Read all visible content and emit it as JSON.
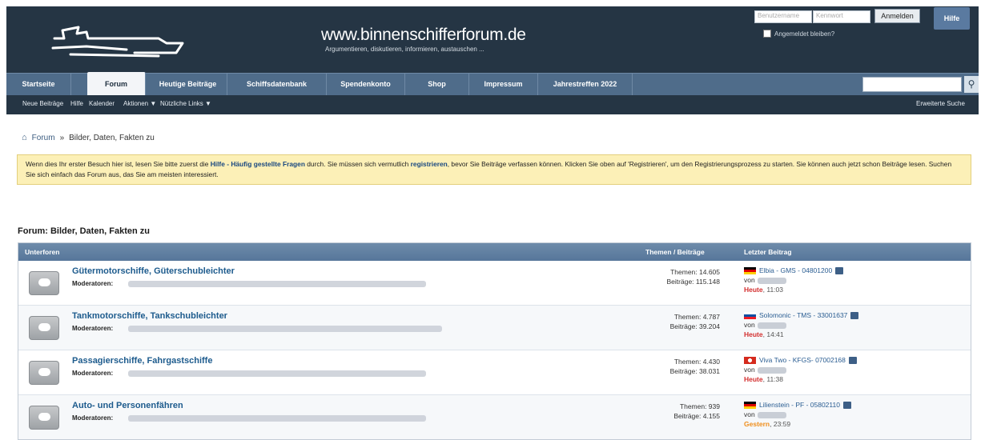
{
  "header": {
    "site_title": "www.binnenschifferforum.de",
    "site_subtitle": "Argumentieren, diskutieren, informieren, austauschen ...",
    "login": {
      "username_placeholder": "Benutzername",
      "password_placeholder": "Kennwort",
      "login_button": "Anmelden",
      "remember_label": "Angemeldet bleiben?"
    },
    "help_button": "Hilfe"
  },
  "nav": {
    "tabs": [
      "Startseite",
      "Forum",
      "Heutige Beiträge",
      "Schiffsdatenbank",
      "Spendenkonto",
      "Shop",
      "Impressum",
      "Jahrestreffen 2022"
    ],
    "active_tab": "Forum",
    "search_icon": "search-icon"
  },
  "subnav": {
    "links": [
      "Neue Beiträge",
      "Hilfe",
      "Kalender",
      "Aktionen ▼",
      "Nützliche Links ▼"
    ],
    "advanced_search": "Erweiterte Suche"
  },
  "breadcrumb": {
    "root": "Forum",
    "separator": "»",
    "current": "Bilder, Daten, Fakten zu"
  },
  "notice": {
    "part1": "Wenn dies Ihr erster Besuch hier ist, lesen Sie bitte zuerst die ",
    "link1": "Hilfe - Häufig gestellte Fragen",
    "part2": " durch. Sie müssen sich vermutlich ",
    "link2": "registrieren",
    "part3": ", bevor Sie Beiträge verfassen können. Klicken Sie oben auf 'Registrieren', um den Registrierungsprozess zu starten. Sie können auch jetzt schon Beiträge lesen. Suchen Sie sich einfach das Forum aus, das Sie am meisten interessiert."
  },
  "forum_heading": "Forum: Bilder, Daten, Fakten zu",
  "table": {
    "col_subforums": "Unterforen",
    "col_stats": "Themen / Beiträge",
    "col_last": "Letzter Beitrag",
    "rows": [
      {
        "title": "Gütermotorschiffe, Güterschubleichter",
        "mods_label": "Moderatoren:",
        "topics": "Themen: 14.605",
        "posts": "Beiträge: 115.148",
        "flag": "de",
        "last_thread": "Elbia - GMS - 04801200",
        "by": "von",
        "day": "Heute",
        "time": ", 11:03",
        "day_type": "today"
      },
      {
        "title": "Tankmotorschiffe, Tankschubleichter",
        "mods_label": "Moderatoren:",
        "topics": "Themen: 4.787",
        "posts": "Beiträge: 39.204",
        "flag": "sk",
        "last_thread": "Solomonic - TMS - 33001637",
        "by": "von",
        "day": "Heute",
        "time": ", 14:41",
        "day_type": "today"
      },
      {
        "title": "Passagierschiffe, Fahrgastschiffe",
        "mods_label": "Moderatoren:",
        "topics": "Themen: 4.430",
        "posts": "Beiträge: 38.031",
        "flag": "ch",
        "last_thread": "Viva Two - KFGS- 07002168",
        "by": "von",
        "day": "Heute",
        "time": ", 11:38",
        "day_type": "today"
      },
      {
        "title": "Auto- und Personenfähren",
        "mods_label": "Moderatoren:",
        "topics": "Themen: 939",
        "posts": "Beiträge: 4.155",
        "flag": "de",
        "last_thread": "Lilienstein - PF - 05802110",
        "by": "von",
        "day": "Gestern",
        "time": ", 23:59",
        "day_type": "yesterday"
      }
    ]
  }
}
